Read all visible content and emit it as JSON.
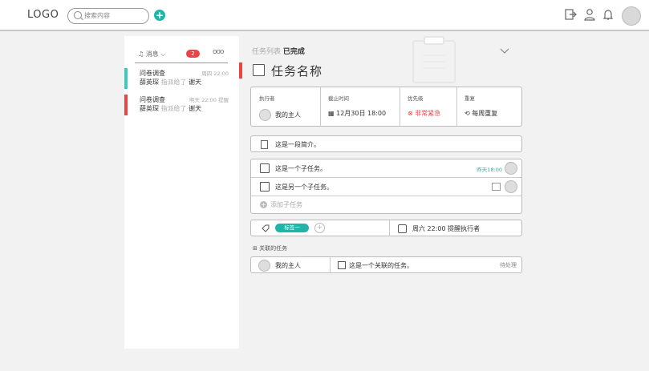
{
  "header": {
    "logo": "LOGO",
    "search_placeholder": "搜索内容",
    "add_label": "+"
  },
  "messages": {
    "title": "消息",
    "count": "2",
    "more": "ooo",
    "items": [
      {
        "title": "问卷调查",
        "time": "周四 22:00",
        "user": "薛英琛",
        "action": "指派给了",
        "target": "谢天",
        "color": "#3ec9c0"
      },
      {
        "title": "问卷调查",
        "time": "明天 22:00 提醒",
        "user": "薛英琛",
        "action": "指派给了",
        "target": "谢天",
        "color": "#e84545"
      }
    ]
  },
  "task": {
    "breadcrumb_list": "任务列表",
    "breadcrumb_status": "已完成",
    "title": "任务名称",
    "fields": {
      "executor_label": "执行者",
      "executor_value": "我的主人",
      "deadline_label": "截止时间",
      "deadline_value": "12月30日 18:00",
      "priority_label": "优先级",
      "priority_value": "非常紧急",
      "repeat_label": "重复",
      "repeat_value": "每周重复"
    },
    "intro": "这是一段简介。",
    "subtasks": [
      {
        "text": "这是一个子任务。",
        "date": "昨天18:00"
      },
      {
        "text": "这是另一个子任务。",
        "date": ""
      }
    ],
    "add_subtask": "添加子任务",
    "tag": "标签一",
    "reminder": "周六 22:00 提醒执行者",
    "related_title": "关联的任务",
    "related": {
      "owner": "我的主人",
      "text": "这是一个关联的任务。",
      "status": "待处理"
    }
  },
  "colors": {
    "accent": "#1fb5a8",
    "urgent": "#e84545"
  }
}
